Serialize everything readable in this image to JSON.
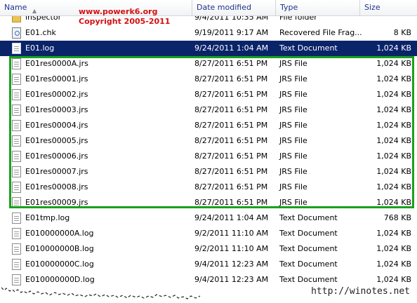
{
  "columns": {
    "name": "Name",
    "date": "Date modified",
    "type": "Type",
    "size": "Size"
  },
  "watermark": {
    "line1": "www.powerk6.org",
    "line2": "Copyright 2005-2011"
  },
  "rows": [
    {
      "name": "inspector",
      "date": "9/4/2011 10:35 AM",
      "type": "File folder",
      "size": "",
      "icon": "folder-icon"
    },
    {
      "name": "E01.chk",
      "date": "9/19/2011 9:17 AM",
      "type": "Recovered File Frag...",
      "size": "8 KB",
      "icon": "chk-file-icon"
    },
    {
      "name": "E01.log",
      "date": "9/24/2011 1:04 AM",
      "type": "Text Document",
      "size": "1,024 KB",
      "icon": "document-icon",
      "selected": true
    },
    {
      "name": "E01res0000A.jrs",
      "date": "8/27/2011 6:51 PM",
      "type": "JRS File",
      "size": "1,024 KB",
      "icon": "document-icon"
    },
    {
      "name": "E01res00001.jrs",
      "date": "8/27/2011 6:51 PM",
      "type": "JRS File",
      "size": "1,024 KB",
      "icon": "document-icon"
    },
    {
      "name": "E01res00002.jrs",
      "date": "8/27/2011 6:51 PM",
      "type": "JRS File",
      "size": "1,024 KB",
      "icon": "document-icon"
    },
    {
      "name": "E01res00003.jrs",
      "date": "8/27/2011 6:51 PM",
      "type": "JRS File",
      "size": "1,024 KB",
      "icon": "document-icon"
    },
    {
      "name": "E01res00004.jrs",
      "date": "8/27/2011 6:51 PM",
      "type": "JRS File",
      "size": "1,024 KB",
      "icon": "document-icon"
    },
    {
      "name": "E01res00005.jrs",
      "date": "8/27/2011 6:51 PM",
      "type": "JRS File",
      "size": "1,024 KB",
      "icon": "document-icon"
    },
    {
      "name": "E01res00006.jrs",
      "date": "8/27/2011 6:51 PM",
      "type": "JRS File",
      "size": "1,024 KB",
      "icon": "document-icon"
    },
    {
      "name": "E01res00007.jrs",
      "date": "8/27/2011 6:51 PM",
      "type": "JRS File",
      "size": "1,024 KB",
      "icon": "document-icon"
    },
    {
      "name": "E01res00008.jrs",
      "date": "8/27/2011 6:51 PM",
      "type": "JRS File",
      "size": "1,024 KB",
      "icon": "document-icon"
    },
    {
      "name": "E01res00009.jrs",
      "date": "8/27/2011 6:51 PM",
      "type": "JRS File",
      "size": "1,024 KB",
      "icon": "document-icon"
    },
    {
      "name": "E01tmp.log",
      "date": "9/24/2011 1:04 AM",
      "type": "Text Document",
      "size": "768 KB",
      "icon": "document-icon"
    },
    {
      "name": "E010000000A.log",
      "date": "9/2/2011 11:10 AM",
      "type": "Text Document",
      "size": "1,024 KB",
      "icon": "document-icon"
    },
    {
      "name": "E010000000B.log",
      "date": "9/2/2011 11:10 AM",
      "type": "Text Document",
      "size": "1,024 KB",
      "icon": "document-icon"
    },
    {
      "name": "E010000000C.log",
      "date": "9/4/2011 12:23 AM",
      "type": "Text Document",
      "size": "1,024 KB",
      "icon": "document-icon"
    },
    {
      "name": "E010000000D.log",
      "date": "9/4/2011 12:23 AM",
      "type": "Text Document",
      "size": "1,024 KB",
      "icon": "document-icon"
    }
  ],
  "credit": "http://winotes.net",
  "colors": {
    "selection": "#0a246a",
    "highlight_frame": "#19a11d",
    "watermark": "#d51010"
  }
}
